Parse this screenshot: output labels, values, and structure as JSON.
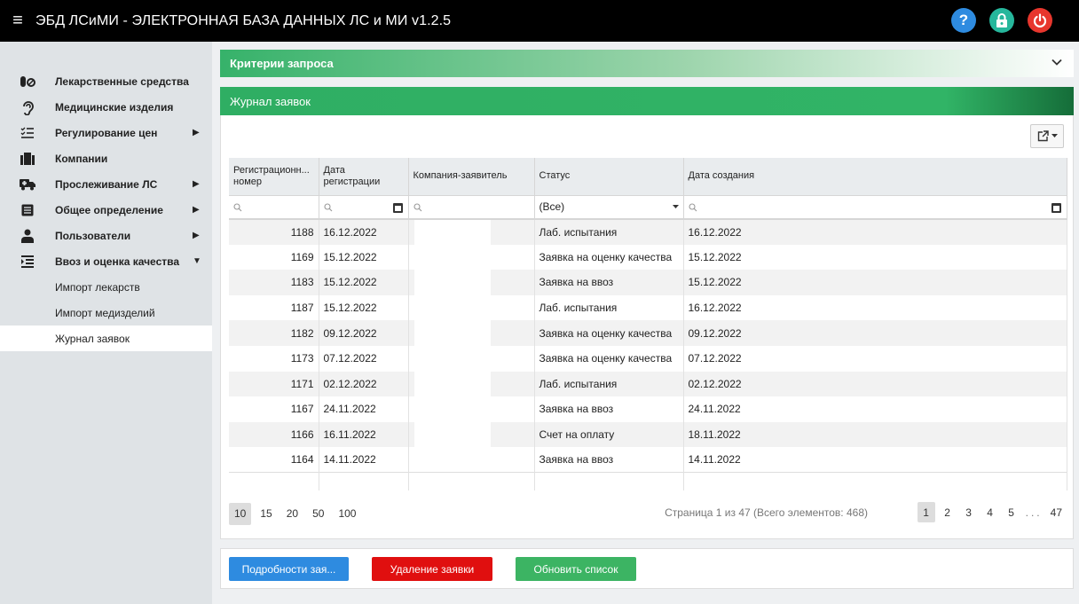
{
  "app": {
    "title": "ЭБД ЛСиМИ - ЭЛЕКТРОННАЯ БАЗА ДАННЫХ ЛС и МИ v1.2.5",
    "help_glyph": "?"
  },
  "sidebar": {
    "items": [
      {
        "label": "Лекарственные средства",
        "icon": "pills-icon"
      },
      {
        "label": "Медицинские изделия",
        "icon": "hearing-aid-icon"
      },
      {
        "label": "Регулирование цен",
        "icon": "checklist-icon"
      },
      {
        "label": "Компании",
        "icon": "building-icon"
      },
      {
        "label": "Прослеживание ЛС",
        "icon": "ambulance-icon"
      },
      {
        "label": "Общее определение",
        "icon": "list-box-icon"
      },
      {
        "label": "Пользователи",
        "icon": "user-icon"
      },
      {
        "label": "Ввоз и оценка качества",
        "icon": "indent-list-icon"
      }
    ],
    "subitems": [
      {
        "label": "Импорт лекарств"
      },
      {
        "label": "Импорт медизделий"
      },
      {
        "label": "Журнал заявок"
      }
    ]
  },
  "criteria": {
    "title": "Критерии запроса"
  },
  "journal": {
    "title": "Журнал заявок"
  },
  "table": {
    "columns": [
      "Регистрационн... номер",
      "Дата регистрации",
      "Компания-заявитель",
      "Статус",
      "Дата создания"
    ],
    "status_filter": "(Все)",
    "rows": [
      {
        "num": "1188",
        "reg_date": "16.12.2022",
        "company": "",
        "status": "Лаб. испытания",
        "created": "16.12.2022"
      },
      {
        "num": "1169",
        "reg_date": "15.12.2022",
        "company": "",
        "status": "Заявка на оценку качества",
        "created": "15.12.2022"
      },
      {
        "num": "1183",
        "reg_date": "15.12.2022",
        "company": "",
        "status": "Заявка на ввоз",
        "created": "15.12.2022"
      },
      {
        "num": "1187",
        "reg_date": "15.12.2022",
        "company": "",
        "status": "Лаб. испытания",
        "created": "16.12.2022"
      },
      {
        "num": "1182",
        "reg_date": "09.12.2022",
        "company": "",
        "status": "Заявка на оценку качества",
        "created": "09.12.2022"
      },
      {
        "num": "1173",
        "reg_date": "07.12.2022",
        "company": "",
        "status": "Заявка на оценку качества",
        "created": "07.12.2022"
      },
      {
        "num": "1171",
        "reg_date": "02.12.2022",
        "company": "",
        "status": "Лаб. испытания",
        "created": "02.12.2022"
      },
      {
        "num": "1167",
        "reg_date": "24.11.2022",
        "company": "",
        "status": "Заявка на ввоз",
        "created": "24.11.2022"
      },
      {
        "num": "1166",
        "reg_date": "16.11.2022",
        "company": "",
        "status": "Счет на оплату",
        "created": "18.11.2022"
      },
      {
        "num": "1164",
        "reg_date": "14.11.2022",
        "company": "",
        "status": "Заявка на ввоз",
        "created": "14.11.2022"
      }
    ]
  },
  "pager": {
    "sizes": [
      "10",
      "15",
      "20",
      "50",
      "100"
    ],
    "info": "Страница 1 из 47 (Всего элементов: 468)",
    "pages": [
      "1",
      "2",
      "3",
      "4",
      "5"
    ],
    "dots": "...",
    "last": "47"
  },
  "actions": {
    "details": "Подробности зая...",
    "delete": "Удаление заявки",
    "refresh": "Обновить список"
  }
}
